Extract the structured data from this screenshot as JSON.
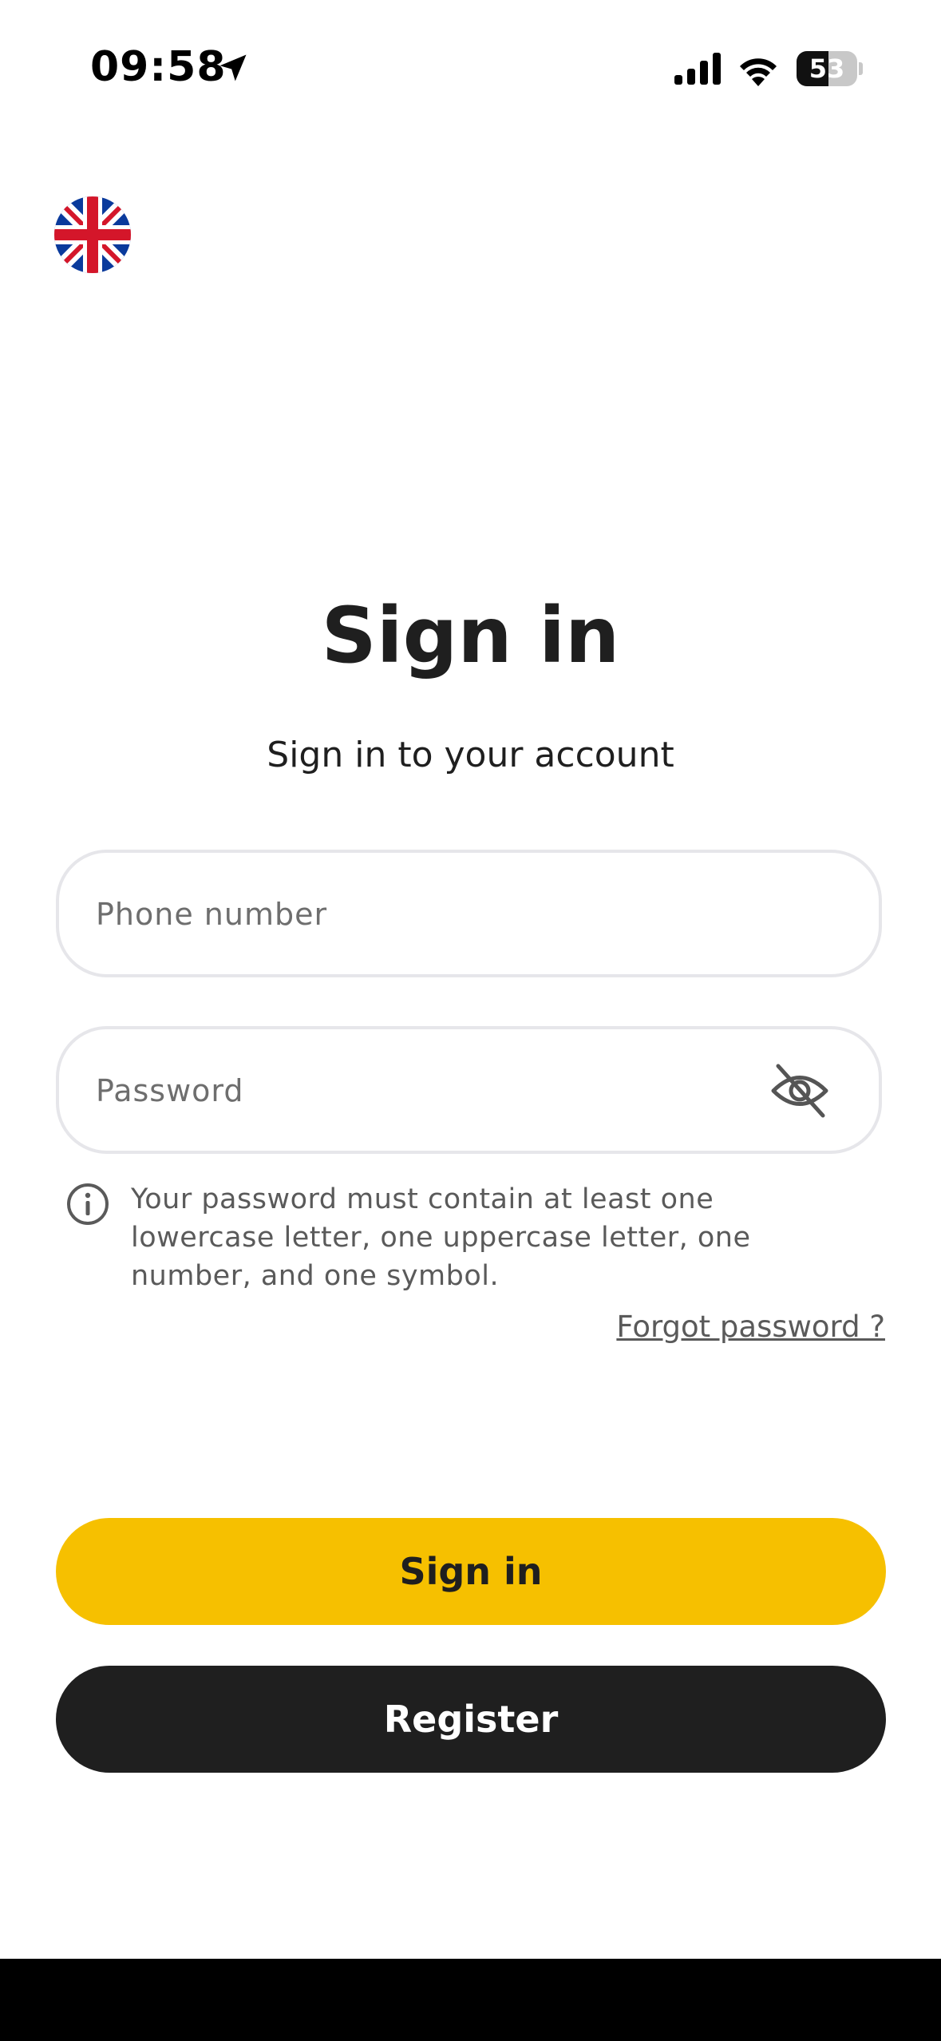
{
  "status_bar": {
    "time": "09:58",
    "battery_level": "53",
    "battery_fraction": 0.53
  },
  "language": {
    "flag_icon": "uk-flag-icon"
  },
  "header": {
    "title": "Sign in",
    "subtitle": "Sign in to your account"
  },
  "form": {
    "phone_placeholder": "Phone number",
    "phone_value": "",
    "password_placeholder": "Password",
    "password_value": "",
    "password_toggle_icon": "eye-off-icon",
    "password_hint": "Your password must contain at least one lowercase letter, one uppercase letter, one number, and one symbol.",
    "forgot_password": "Forgot password ?"
  },
  "actions": {
    "signin_label": "Sign in",
    "register_label": "Register"
  },
  "colors": {
    "primary": "#f6c000",
    "dark": "#1f1f1f"
  }
}
